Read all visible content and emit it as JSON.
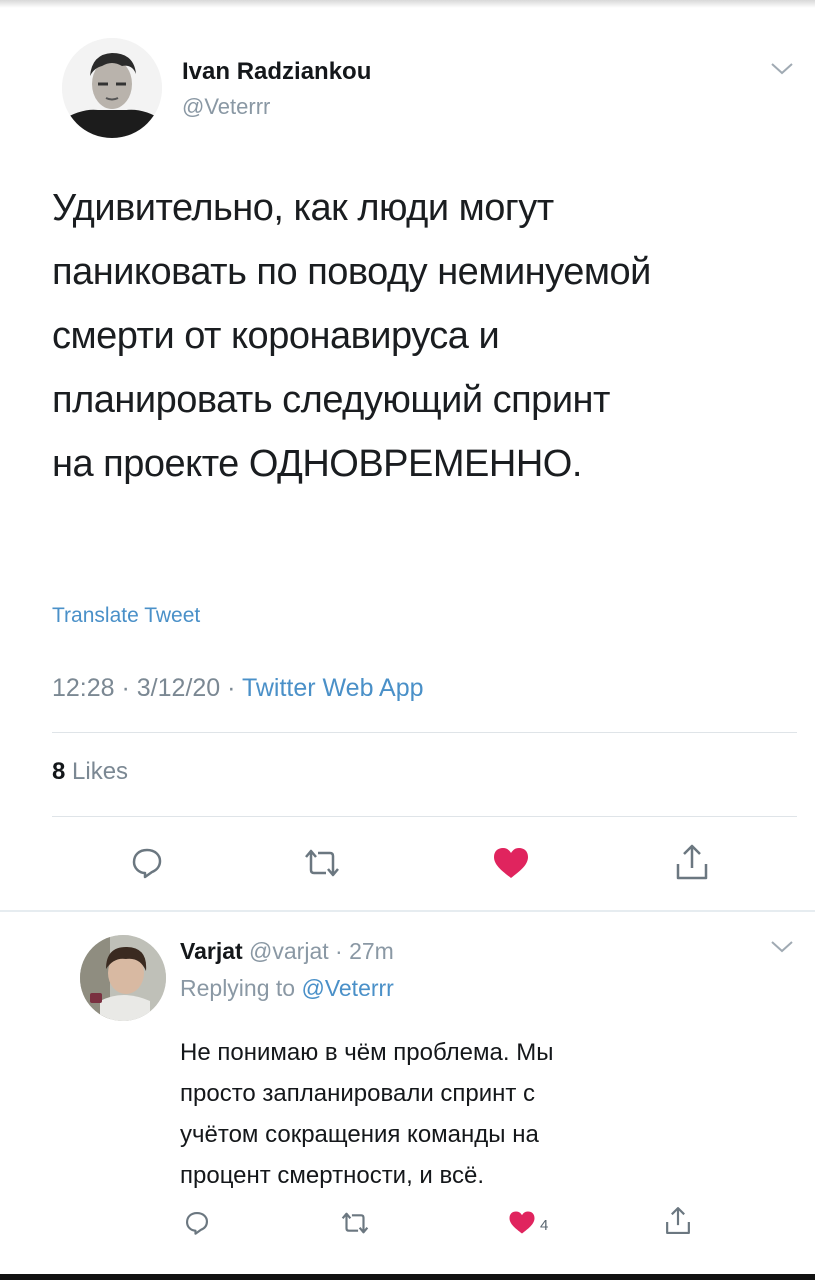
{
  "tweet": {
    "author_name": "Ivan Radziankou",
    "author_handle": "@Veterrr",
    "text_lines": [
      "Удивительно, как люди могут",
      "паниковать по поводу неминуемой",
      "смерти от коронавируса и",
      "планировать следующий спринт",
      "на проекте ОДНОВРЕМЕННО."
    ],
    "translate_label": "Translate Tweet",
    "time": "12:28",
    "date": "3/12/20",
    "separator": " · ",
    "source": "Twitter Web App",
    "likes_count": "8",
    "likes_label": "Likes",
    "actions": [
      "reply-icon",
      "retweet-icon",
      "like-icon",
      "share-icon"
    ]
  },
  "reply": {
    "author_name": "Varjat",
    "author_handle": "@varjat",
    "age": "27m",
    "replying_prefix": "Replying to ",
    "replying_to": "@Veterrr",
    "text_lines": [
      "Не понимаю в чём проблема. Мы",
      "просто запланировали спринт с",
      "учётом сокращения команды на",
      "процент смертности, и всё."
    ],
    "like_count": "4"
  },
  "colors": {
    "accent": "#4a90c8",
    "like": "#e0245e",
    "muted": "#8a98a4",
    "text": "#14171a"
  }
}
